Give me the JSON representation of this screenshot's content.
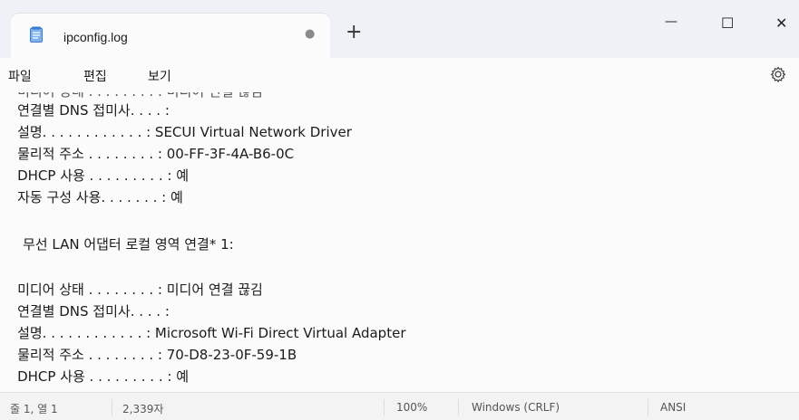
{
  "tab": {
    "title": "ipconfig.log",
    "unsaved_marker": "●",
    "new_tab": "+"
  },
  "window_controls": {
    "minimize": "—",
    "maximize": "☐",
    "close": "✕"
  },
  "menu": {
    "file": "파일",
    "edit": "편집",
    "view": "보기",
    "settings_icon": "gear-icon"
  },
  "editor": {
    "lines": [
      "    연결별 DNS 접미사. . . . :",
      "    설명. . . . . . . . . . . . : SECUI Virtual Network Driver",
      "    물리적 주소 . . . . . . . . : 00-FF-3F-4A-B6-0C",
      "    DHCP 사용 . . . . . . . . . : 예",
      "    자동 구성 사용. . . . . . . : 예",
      "",
      "무선 LAN 어댑터 로컬 영역 연결* 1:",
      "",
      "    미디어 상태 . . . . . . . . : 미디어 연결 끊김",
      "    연결별 DNS 접미사. . . . :",
      "    설명. . . . . . . . . . . . : Microsoft Wi-Fi Direct Virtual Adapter",
      "    물리적 주소 . . . . . . . . : 70-D8-23-0F-59-1B",
      "    DHCP 사용 . . . . . . . . . : 예"
    ]
  },
  "status": {
    "position": "줄 1, 열 1",
    "chars": "2,339자",
    "zoom": "100%",
    "line_ending": "Windows (CRLF)",
    "encoding": "ANSI"
  },
  "colors": {
    "accent": "#0067c0",
    "icon_blue": "#3a7bd5"
  }
}
